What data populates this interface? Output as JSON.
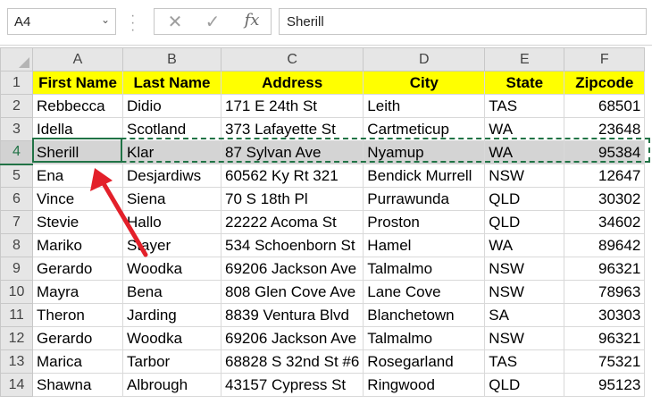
{
  "formula_bar": {
    "name_box": "A4",
    "name_box_caret": "⌄",
    "cancel_glyph": "✕",
    "enter_glyph": "✓",
    "fx_glyph": "fx",
    "formula_value": "Sherill"
  },
  "columns": [
    "A",
    "B",
    "C",
    "D",
    "E",
    "F"
  ],
  "row_numbers": [
    "1",
    "2",
    "3",
    "4",
    "5",
    "6",
    "7",
    "8",
    "9",
    "10",
    "11",
    "12",
    "13",
    "14"
  ],
  "header": {
    "first_name": "First Name",
    "last_name": "Last Name",
    "address": "Address",
    "city": "City",
    "state": "State",
    "zipcode": "Zipcode"
  },
  "rows": [
    {
      "first": "Rebbecca",
      "last": "Didio",
      "address": "171 E 24th St",
      "city": "Leith",
      "state": "TAS",
      "zip": "68501"
    },
    {
      "first": "Idella",
      "last": "Scotland",
      "address": "373 Lafayette St",
      "city": "Cartmeticup",
      "state": "WA",
      "zip": "23648"
    },
    {
      "first": "Sherill",
      "last": "Klar",
      "address": "87 Sylvan Ave",
      "city": "Nyamup",
      "state": "WA",
      "zip": "95384"
    },
    {
      "first": "Ena",
      "last": "Desjardiws",
      "address": "60562 Ky Rt 321",
      "city": "Bendick Murrell",
      "state": "NSW",
      "zip": "12647"
    },
    {
      "first": "Vince",
      "last": "Siena",
      "address": "70 S 18th Pl",
      "city": "Purrawunda",
      "state": "QLD",
      "zip": "30302"
    },
    {
      "first": "Stevie",
      "last": "Hallo",
      "address": "22222 Acoma St",
      "city": "Proston",
      "state": "QLD",
      "zip": "34602"
    },
    {
      "first": "Mariko",
      "last": "Stayer",
      "address": "534 Schoenborn St",
      "city": "Hamel",
      "state": "WA",
      "zip": "89642"
    },
    {
      "first": "Gerardo",
      "last": "Woodka",
      "address": "69206 Jackson Ave",
      "city": "Talmalmo",
      "state": "NSW",
      "zip": "96321"
    },
    {
      "first": "Mayra",
      "last": "Bena",
      "address": "808 Glen Cove Ave",
      "city": "Lane Cove",
      "state": "NSW",
      "zip": "78963"
    },
    {
      "first": "Theron",
      "last": "Jarding",
      "address": "8839 Ventura Blvd",
      "city": "Blanchetown",
      "state": "SA",
      "zip": "30303"
    },
    {
      "first": "Gerardo",
      "last": "Woodka",
      "address": "69206 Jackson Ave",
      "city": "Talmalmo",
      "state": "NSW",
      "zip": "96321"
    },
    {
      "first": "Marica",
      "last": "Tarbor",
      "address": "68828 S 32nd St #6",
      "city": "Rosegarland",
      "state": "TAS",
      "zip": "75321"
    },
    {
      "first": "Shawna",
      "last": "Albrough",
      "address": "43157 Cypress St",
      "city": "Ringwood",
      "state": "QLD",
      "zip": "95123"
    }
  ],
  "colors": {
    "header_fill": "#ffff00",
    "selected_row_fill": "#d4d4d4",
    "selection_border": "#217346",
    "annotation_arrow": "#e3202a"
  }
}
